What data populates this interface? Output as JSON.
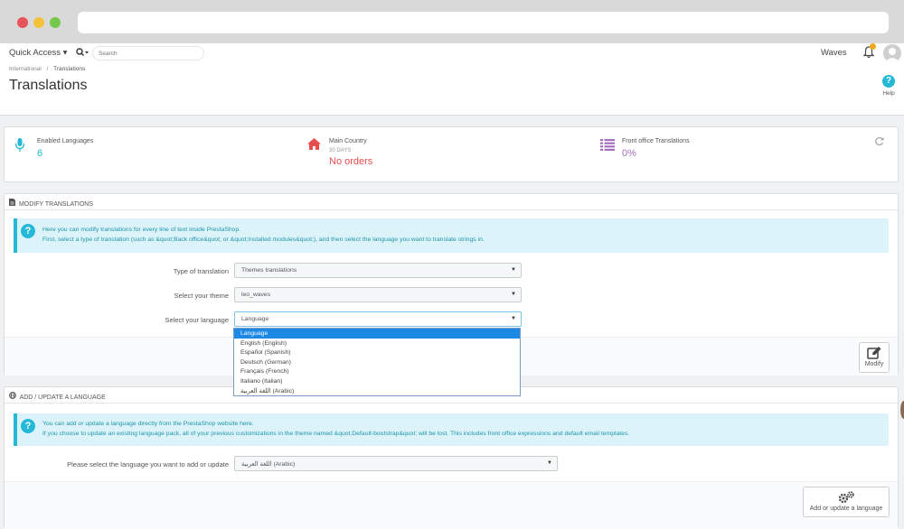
{
  "header": {
    "quick_access": "Quick Access ▾",
    "search_placeholder": "Search",
    "shop_name": "Waves",
    "notifications_count": ""
  },
  "breadcrumb": {
    "parent": "International",
    "separator": "/",
    "current": "Translations"
  },
  "page": {
    "title": "Translations",
    "help_label": "Help"
  },
  "kpis": [
    {
      "label": "Enabled Languages",
      "sub": "",
      "value": "6",
      "color": "#25b9d7",
      "icon": "microphone-icon"
    },
    {
      "label": "Main Country",
      "sub": "30 DAYS",
      "value": "No orders",
      "color": "#e84e4e",
      "icon": "home-icon"
    },
    {
      "label": "Front office Translations",
      "sub": "",
      "value": "0%",
      "color": "#a36fbe",
      "icon": "list-icon"
    }
  ],
  "modify_panel": {
    "title": "MODIFY TRANSLATIONS",
    "alert_line1": "Here you can modify translations for every line of text inside PrestaShop.",
    "alert_line2": "First, select a type of translation (such as &quot;Back office&quot; or &quot;Installed modules&quot;), and then select the language you want to translate strings in.",
    "type_label": "Type of translation",
    "type_value": "Themes translations",
    "theme_label": "Select your theme",
    "theme_value": "leo_waves",
    "language_label": "Select your language",
    "language_value": "Language",
    "language_options": [
      "Language",
      "English (English)",
      "Español (Spanish)",
      "Deutsch (German)",
      "Français (French)",
      "Italiano (Italian)",
      "اللغة العربية (Arabic)"
    ],
    "modify_button": "Modify"
  },
  "add_panel": {
    "title": "ADD / UPDATE A LANGUAGE",
    "alert_line1": "You can add or update a language directly from the PrestaShop website here.",
    "alert_line2": "If you choose to update an existing language pack, all of your previous customizations in the theme named &quot;Default-bootstrap&quot; will be lost. This includes front office expressions and default email templates.",
    "select_label": "Please select the language you want to add or update",
    "select_value": "اللغة العربية (Arabic)",
    "add_button": "Add or update a language"
  },
  "colors": {
    "accent": "#25b9d7",
    "danger": "#e84e4e",
    "purple": "#a36fbe",
    "selected_option": "#1e88e5"
  }
}
